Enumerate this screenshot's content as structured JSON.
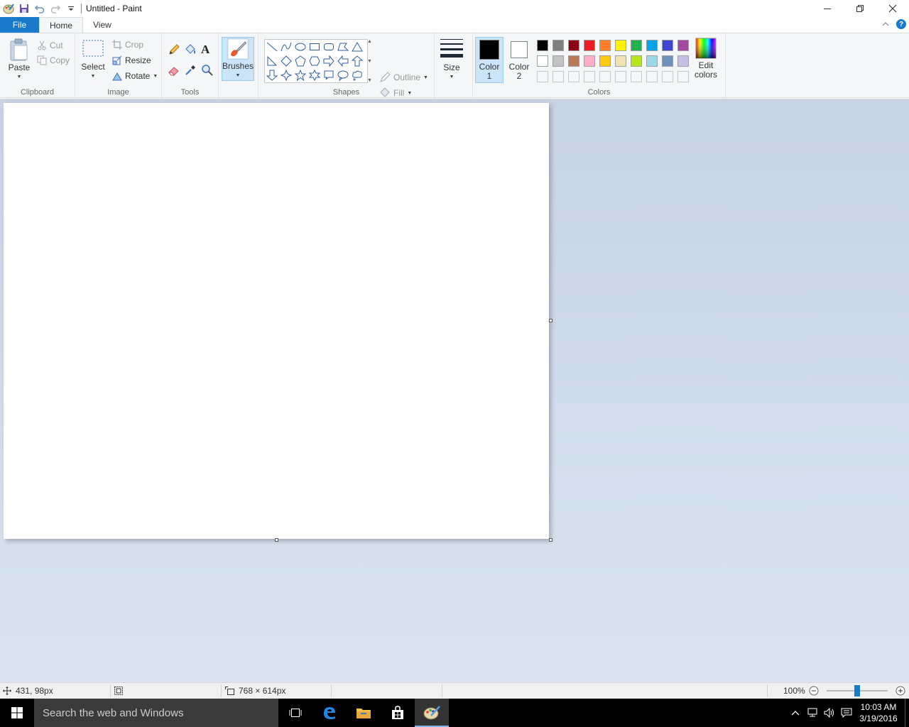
{
  "app": {
    "title": "Untitled - Paint"
  },
  "tabs": [
    {
      "label": "File"
    },
    {
      "label": "Home"
    },
    {
      "label": "View"
    }
  ],
  "clipboard": {
    "paste": "Paste",
    "cut": "Cut",
    "copy": "Copy",
    "group": "Clipboard"
  },
  "image": {
    "select": "Select",
    "crop": "Crop",
    "resize": "Resize",
    "rotate": "Rotate",
    "group": "Image"
  },
  "tools": {
    "group": "Tools"
  },
  "brushes": {
    "label": "Brushes"
  },
  "shapes": {
    "outline": "Outline",
    "fill": "Fill",
    "group": "Shapes"
  },
  "size": {
    "label": "Size"
  },
  "colors": {
    "color1_line1": "Color",
    "color1_line2": "1",
    "color2_line1": "Color",
    "color2_line2": "2",
    "edit_line1": "Edit",
    "edit_line2": "colors",
    "group": "Colors",
    "color1_value": "#000000",
    "color2_value": "#ffffff",
    "palette": [
      "#000000",
      "#7f7f7f",
      "#880015",
      "#ed1c24",
      "#ff7f27",
      "#fff200",
      "#22b14c",
      "#00a2e8",
      "#3f48cc",
      "#a349a4",
      "#ffffff",
      "#c3c3c3",
      "#b97a57",
      "#ffaec9",
      "#ffc90e",
      "#efe4b0",
      "#b5e61d",
      "#99d9ea",
      "#7092be",
      "#c8bfe7",
      "",
      "",
      "",
      "",
      "",
      "",
      "",
      "",
      "",
      ""
    ]
  },
  "status": {
    "cursor_pos": "431, 98px",
    "canvas_size": "768 × 614px",
    "zoom": "100%",
    "zoom_level": 0.5
  },
  "taskbar": {
    "search_placeholder": "Search the web and Windows",
    "time": "10:03 AM",
    "date": "3/19/2016"
  }
}
